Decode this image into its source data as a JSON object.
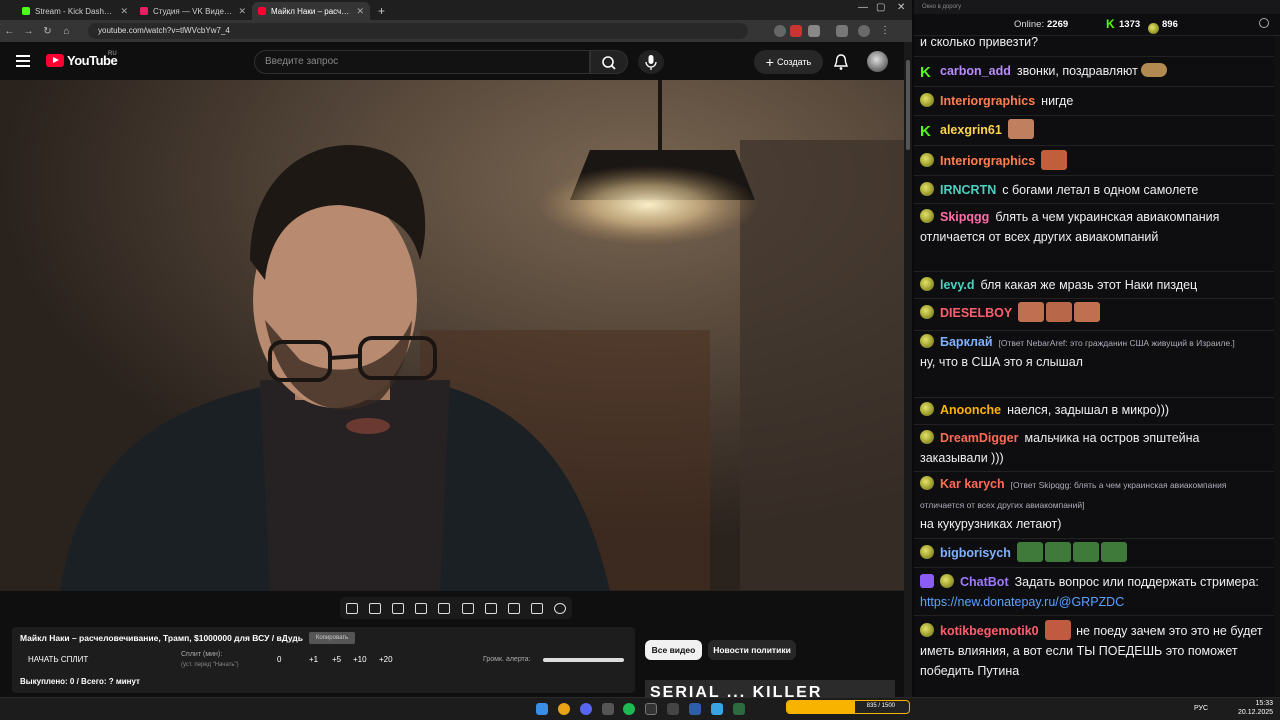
{
  "browser": {
    "tabs": [
      {
        "title": "Stream - Kick Dashboard",
        "color": "#53fc18",
        "active": false
      },
      {
        "title": "Студия — VK Видео Live",
        "color": "#e91e63",
        "active": false
      },
      {
        "title": "Майкл Наки – расчеловечивание...",
        "color": "#ff0033",
        "active": true
      }
    ],
    "url": "youtube.com/watch?v=tlWVcbYw7_4"
  },
  "youtube": {
    "logo_text": "YouTube",
    "country": "RU",
    "search_placeholder": "Введите запрос",
    "create_label": "Создать"
  },
  "panel": {
    "title": "Майкл Наки – расчеловечивание, Трамп, $1000000 для ВСУ / вДудь",
    "copy_label": "Копировать",
    "start_split_label": "НАЧАТЬ СПЛИТ",
    "split_label": "Сплит (мин):",
    "split_hint": "(уст. перед \"Начать\")",
    "split_value": "0",
    "increments": [
      "+1",
      "+5",
      "+10",
      "+20"
    ],
    "alert_volume_label": "Громк. алерта:",
    "status": "Выкуплено: 0 / Всего: ? минут"
  },
  "chips": {
    "all_videos": "Все видео",
    "politics_news": "Новости политики"
  },
  "recommended": {
    "thumb_text": "SERIAL ... KILLER"
  },
  "chat": {
    "window_title": "Окно в дорогу",
    "online_label": "Online:",
    "online_count": "2269",
    "kick_count": "1373",
    "other_count": "896",
    "messages": [
      {
        "text": "и сколько привезти?"
      },
      {
        "nick": "carbon_add",
        "color": "#b98cff",
        "text": "звонки, поздравляют"
      },
      {
        "nick": "Interiorgraphics",
        "color": "#ff7f50",
        "text": "нигде"
      },
      {
        "nick": "alexgrin61",
        "color": "#ffd54f",
        "text": ""
      },
      {
        "nick": "Interiorgraphics",
        "color": "#ff7f50",
        "text": ""
      },
      {
        "nick": "IRNCRTN",
        "color": "#4dd0c0",
        "text": "с богами летал в одном самолете"
      },
      {
        "nick": "Skipqgg",
        "color": "#ff6fa8",
        "text": "блять а чем украинская авиакомпания отличается от всех других авиакомпаний"
      },
      {
        "nick": "levy.d",
        "color": "#4dd0c0",
        "text": "бля какая же мразь этот Наки пиздец"
      },
      {
        "nick": "DIESELBOY",
        "color": "#ff5f6d",
        "text": ""
      },
      {
        "nick": "Барклай",
        "color": "#7fb2ff",
        "reply": "[Ответ NebarAref: это гражданин США живущий в Израиле.]",
        "text": "ну, что в США это я слышал"
      },
      {
        "nick": "Anoonche",
        "color": "#ffb300",
        "text": "наелся, задышал в микро)))"
      },
      {
        "nick": "DreamDigger",
        "color": "#ff6b57",
        "text": "мальчика на остров эпштейна заказывали )))"
      },
      {
        "nick": "Kar karych",
        "color": "#ff6b57",
        "reply": "[Ответ Skipqgg: блять а чем украинская авиакомпания отличается от всех других авиакомпаний]",
        "text": "на кукурузниках летают)"
      },
      {
        "nick": "bigborisych",
        "color": "#7fb2ff",
        "text": ""
      },
      {
        "nick": "ChatBot",
        "color": "#9f7aff",
        "text": "Задать вопрос или поддержать стримера:",
        "link": "https://new.donatepay.ru/@GRPZDC"
      },
      {
        "nick": "kotikbegemotik0",
        "color": "#ff5f6d",
        "text": "не поеду зачем это это не будет иметь влияния, а вот если ТЫ ПОЕДЕШЬ это поможет победить Путина"
      }
    ]
  },
  "taskbar": {
    "donate_goal": "835 / 1500",
    "donate_fraction": 0.557,
    "lang": "РУС",
    "time": "15:33",
    "date": "20.12.2025"
  }
}
